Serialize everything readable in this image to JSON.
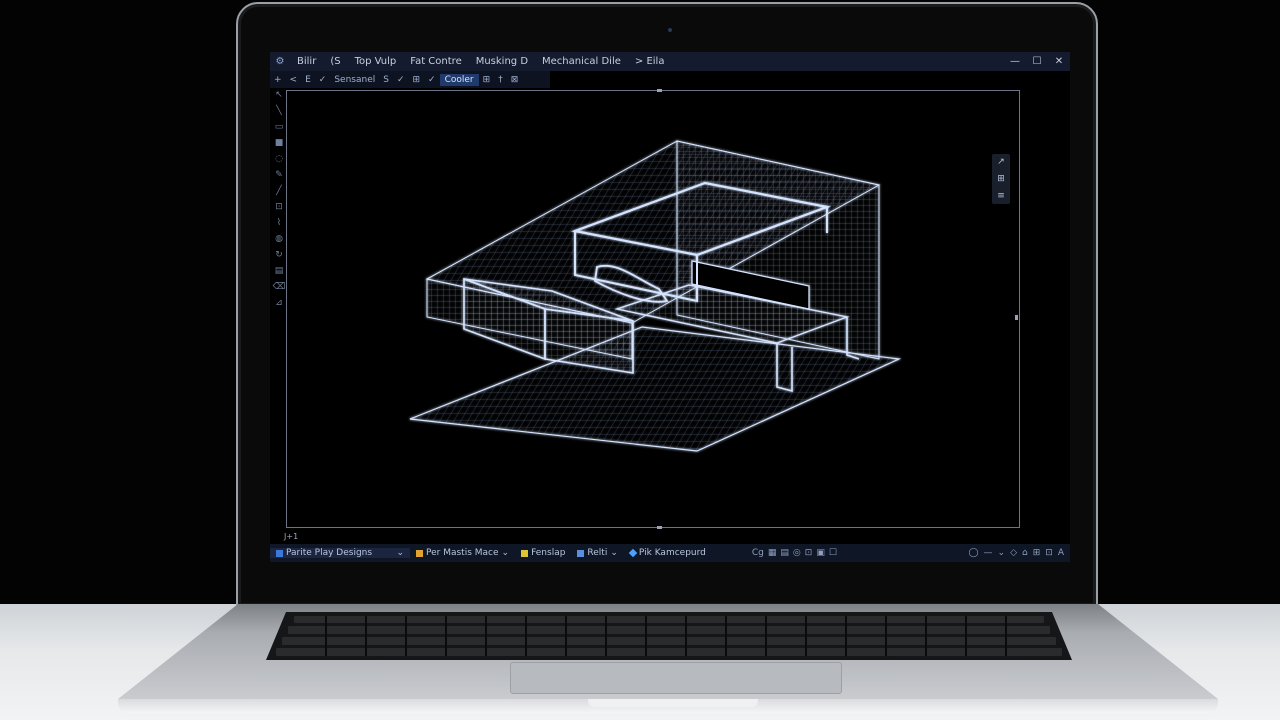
{
  "window": {
    "menu": [
      "Bilir",
      "(S",
      "Top Vulp",
      "Fat Contre",
      "Musking D",
      "Mechanical Dile",
      "> Eila"
    ],
    "controls": {
      "minimize": "—",
      "maximize": "☐",
      "close": "✕"
    }
  },
  "toolbar": {
    "items": [
      "+",
      "<",
      "E",
      "✓",
      "Sensanel",
      "S",
      "✓",
      "⊞",
      "✓"
    ],
    "active_label": "Cooler",
    "extra": [
      "⊞",
      "†",
      "⊠"
    ]
  },
  "viewport": {
    "coordinate_label": "J+1"
  },
  "statusbar": {
    "workspace": "Parite Play Designs",
    "workspace_caret": "⌄",
    "item2": "Per Mastis Mace",
    "item2_caret": "⌄",
    "item3": "Fenslap",
    "item4": "Relti",
    "item4_caret": "⌄",
    "item5": "Pik Kamcepurd",
    "mid_label": "Cg",
    "right_icons": [
      "◯",
      "—",
      "⌄",
      "◇",
      "⌂",
      "⊞",
      "⊡",
      "A"
    ]
  },
  "colors": {
    "titlebar_bg": "#141b2e",
    "statusbar_bg": "#0f1626",
    "accent_blue": "#1f3a6b",
    "wireframe": "#c8dcff"
  }
}
